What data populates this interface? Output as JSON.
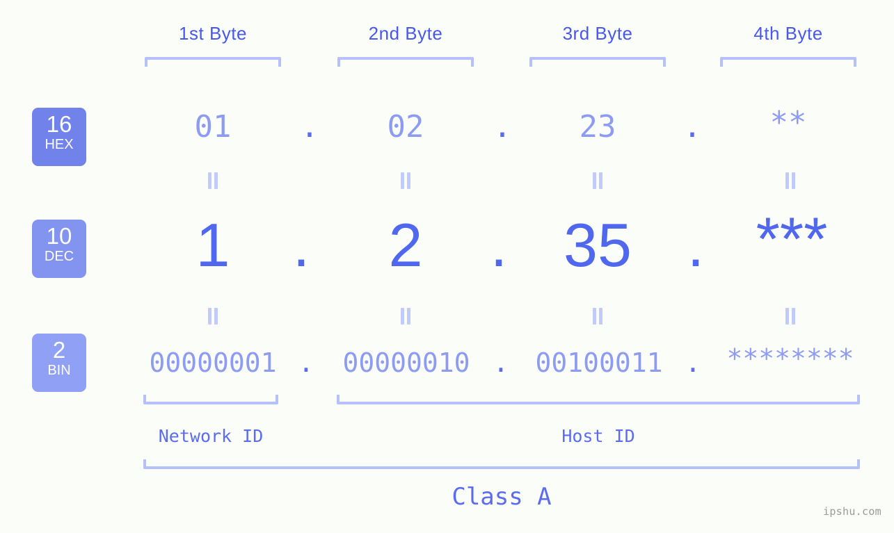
{
  "page": {
    "background": "#fbfdf8",
    "watermark": "ipshu.com"
  },
  "colors": {
    "header_blue": "#4758ef",
    "bracket_blue": "#b6c0fb",
    "light_value": "#8d9bf3",
    "strong_value": "#5068ee",
    "dot_blue": "#5b6cf0",
    "badge_hex": "#7182ea",
    "badge_dec": "#8293f0",
    "badge_bin": "#8fa0f5",
    "connector": "#c2caf9",
    "watermark": "#9a9a9a"
  },
  "byte_headers": [
    {
      "label": "1st Byte"
    },
    {
      "label": "2nd Byte"
    },
    {
      "label": "3rd Byte"
    },
    {
      "label": "4th Byte"
    }
  ],
  "bases": [
    {
      "number": "16",
      "name": "HEX"
    },
    {
      "number": "10",
      "name": "DEC"
    },
    {
      "number": "2",
      "name": "BIN"
    }
  ],
  "rows": {
    "hex": {
      "base_number": "16",
      "base_name": "HEX",
      "values": [
        "01",
        "02",
        "23",
        "**"
      ],
      "separators": [
        ".",
        ".",
        "."
      ]
    },
    "dec": {
      "base_number": "10",
      "base_name": "DEC",
      "values": [
        "1",
        "2",
        "35",
        "***"
      ],
      "separators": [
        ".",
        ".",
        "."
      ]
    },
    "bin": {
      "base_number": "2",
      "base_name": "BIN",
      "values": [
        "00000001",
        "00000010",
        "00100011",
        "********"
      ],
      "separators": [
        ".",
        ".",
        "."
      ]
    }
  },
  "connectors": {
    "glyph": "=",
    "count_per_row": 4
  },
  "segments": {
    "network_id": "Network ID",
    "host_id": "Host ID",
    "class": "Class A"
  }
}
